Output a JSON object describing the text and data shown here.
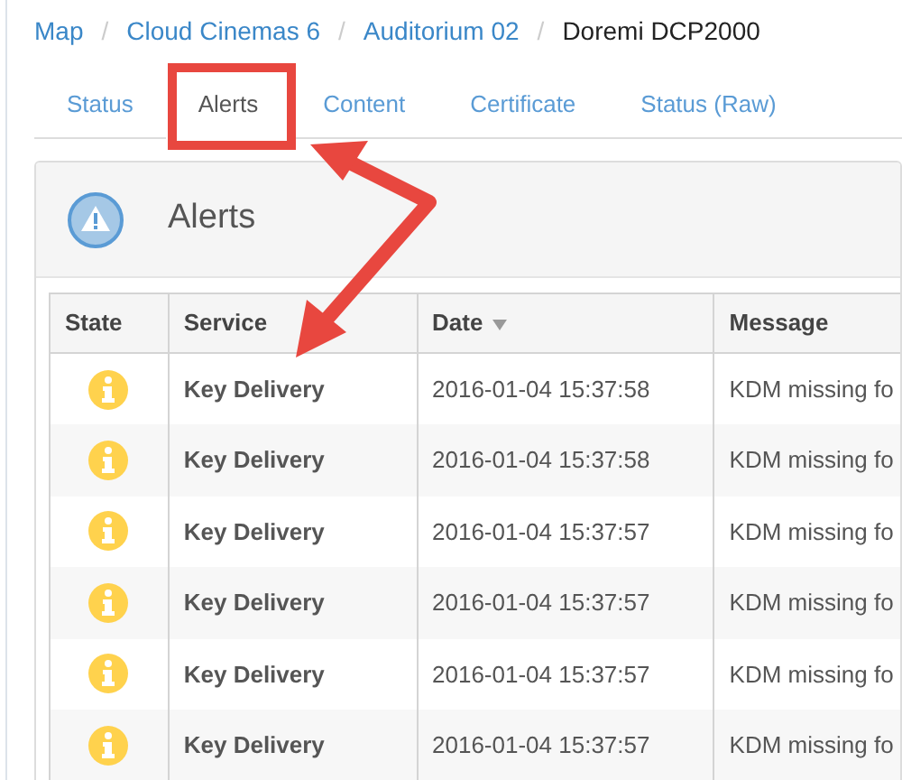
{
  "breadcrumb": [
    {
      "label": "Map",
      "link": true
    },
    {
      "separator": "/",
      "label": "Cloud Cinemas 6",
      "link": true
    },
    {
      "separator": "/",
      "label": "Auditorium 02",
      "link": true
    },
    {
      "separator": "/",
      "label": "Doremi DCP2000",
      "link": false
    }
  ],
  "tabs": [
    {
      "label": "Status",
      "selected": false
    },
    {
      "label": "Alerts",
      "selected": true
    },
    {
      "label": "Content",
      "selected": false
    },
    {
      "label": "Certificate",
      "selected": false
    },
    {
      "label": "Status (Raw)",
      "selected": false
    }
  ],
  "panel": {
    "title": "Alerts"
  },
  "table": {
    "columns": [
      {
        "label": "State",
        "sorted": false
      },
      {
        "label": "Service",
        "sorted": false
      },
      {
        "label": "Date",
        "sorted": true
      },
      {
        "label": "Message",
        "sorted": false
      }
    ],
    "rows": [
      {
        "kind": "info",
        "service": "Key Delivery",
        "date": "2016-01-04 15:37:58",
        "message": "KDM missing fo"
      },
      {
        "kind": "info",
        "service": "Key Delivery",
        "date": "2016-01-04 15:37:58",
        "message": "KDM missing fo"
      },
      {
        "kind": "info",
        "service": "Key Delivery",
        "date": "2016-01-04 15:37:57",
        "message": "KDM missing fo"
      },
      {
        "kind": "info",
        "service": "Key Delivery",
        "date": "2016-01-04 15:37:57",
        "message": "KDM missing fo"
      },
      {
        "kind": "info",
        "service": "Key Delivery",
        "date": "2016-01-04 15:37:57",
        "message": "KDM missing fo"
      },
      {
        "kind": "info",
        "service": "Key Delivery",
        "date": "2016-01-04 15:37:57",
        "message": "KDM missing fo"
      }
    ]
  }
}
